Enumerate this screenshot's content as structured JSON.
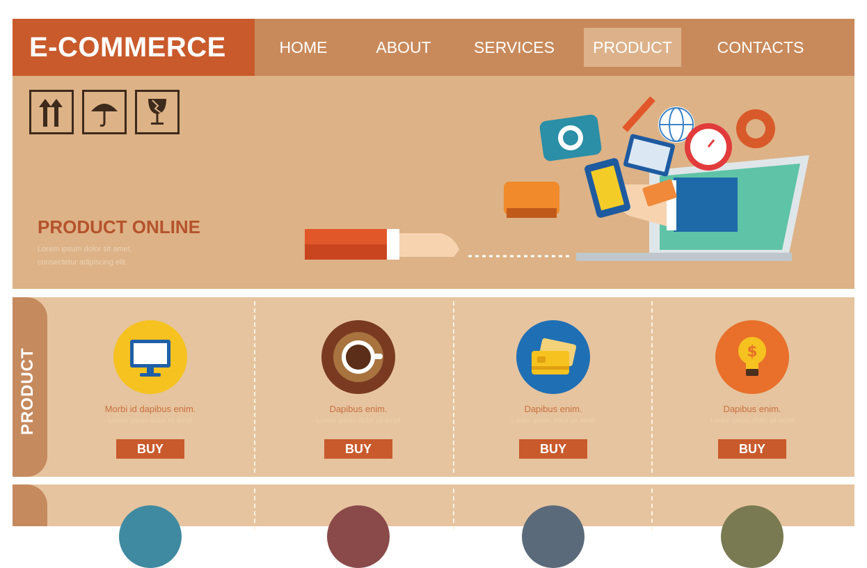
{
  "header": {
    "logo": "E-COMMERCE",
    "nav": [
      "HOME",
      "ABOUT",
      "SERVICES",
      "PRODUCT",
      "CONTACTS"
    ],
    "active_nav": "PRODUCT"
  },
  "hero": {
    "title": "PRODUCT ONLINE",
    "subtitle_line1": "Lorem ipsum dolor sit amet,",
    "subtitle_line2": "consectetur adipiscing elit."
  },
  "products": {
    "section_label": "PRODUCT",
    "items": [
      {
        "title": "Morbi id dapibus enim.",
        "text": "Lorem ipsum dolor sit amet",
        "button": "BUY",
        "icon": "monitor-icon"
      },
      {
        "title": "Dapibus enim.",
        "text": "Lorem ipsum dolor sit amet",
        "button": "BUY",
        "icon": "coffee-icon"
      },
      {
        "title": "Dapibus enim.",
        "text": "Lorem ipsum dolor sit amet",
        "button": "BUY",
        "icon": "credit-card-icon"
      },
      {
        "title": "Dapibus enim.",
        "text": "Lorem ipsum dolor sit amet",
        "button": "BUY",
        "icon": "lightbulb-icon"
      }
    ]
  },
  "colors": {
    "logo_bg": "#c95a2c",
    "header_bg": "#c98a5b",
    "hero_bg": "#ddb286",
    "band_bg": "#e6c49f",
    "accent": "#c95a2c"
  }
}
